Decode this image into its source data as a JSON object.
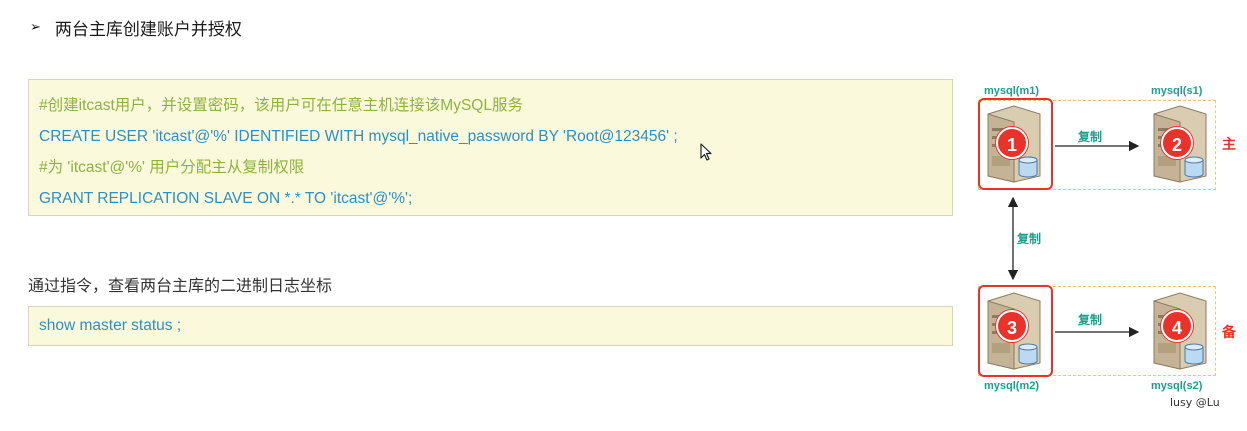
{
  "heading": {
    "bullet": "➢",
    "text": "两台主库创建账户并授权"
  },
  "code_block_1": {
    "lines": [
      {
        "type": "comment",
        "text": "#创建itcast用户，并设置密码，该用户可在任意主机连接该MySQL服务"
      },
      {
        "type": "code",
        "text": "CREATE  USER  'itcast'@'%'  IDENTIFIED WITH mysql_native_password BY 'Root@123456' ;"
      },
      {
        "type": "comment",
        "text": "#为 'itcast'@'%' 用户分配主从复制权限"
      },
      {
        "type": "code",
        "text": "GRANT  REPLICATION  SLAVE  ON  *.*  TO  'itcast'@'%';"
      }
    ]
  },
  "subheading": "通过指令，查看两台主库的二进制日志坐标",
  "code_block_2": {
    "text": "show  master  status ;"
  },
  "diagram": {
    "servers": [
      {
        "label": "mysql(m1)",
        "number": "1"
      },
      {
        "label": "mysql(s1)",
        "number": "2"
      },
      {
        "label": "mysql(m2)",
        "number": "3"
      },
      {
        "label": "mysql(s2)",
        "number": "4"
      }
    ],
    "arrow_labels": {
      "top": "复制",
      "middle": "复制",
      "bottom": "复制"
    },
    "side_labels": {
      "top": "主",
      "bottom": "备"
    },
    "colors": {
      "accent_red": "#e8322a",
      "label_teal": "#1aa08c",
      "dash_orange": "#f1c67c"
    }
  },
  "watermark": "lusy @Lu"
}
